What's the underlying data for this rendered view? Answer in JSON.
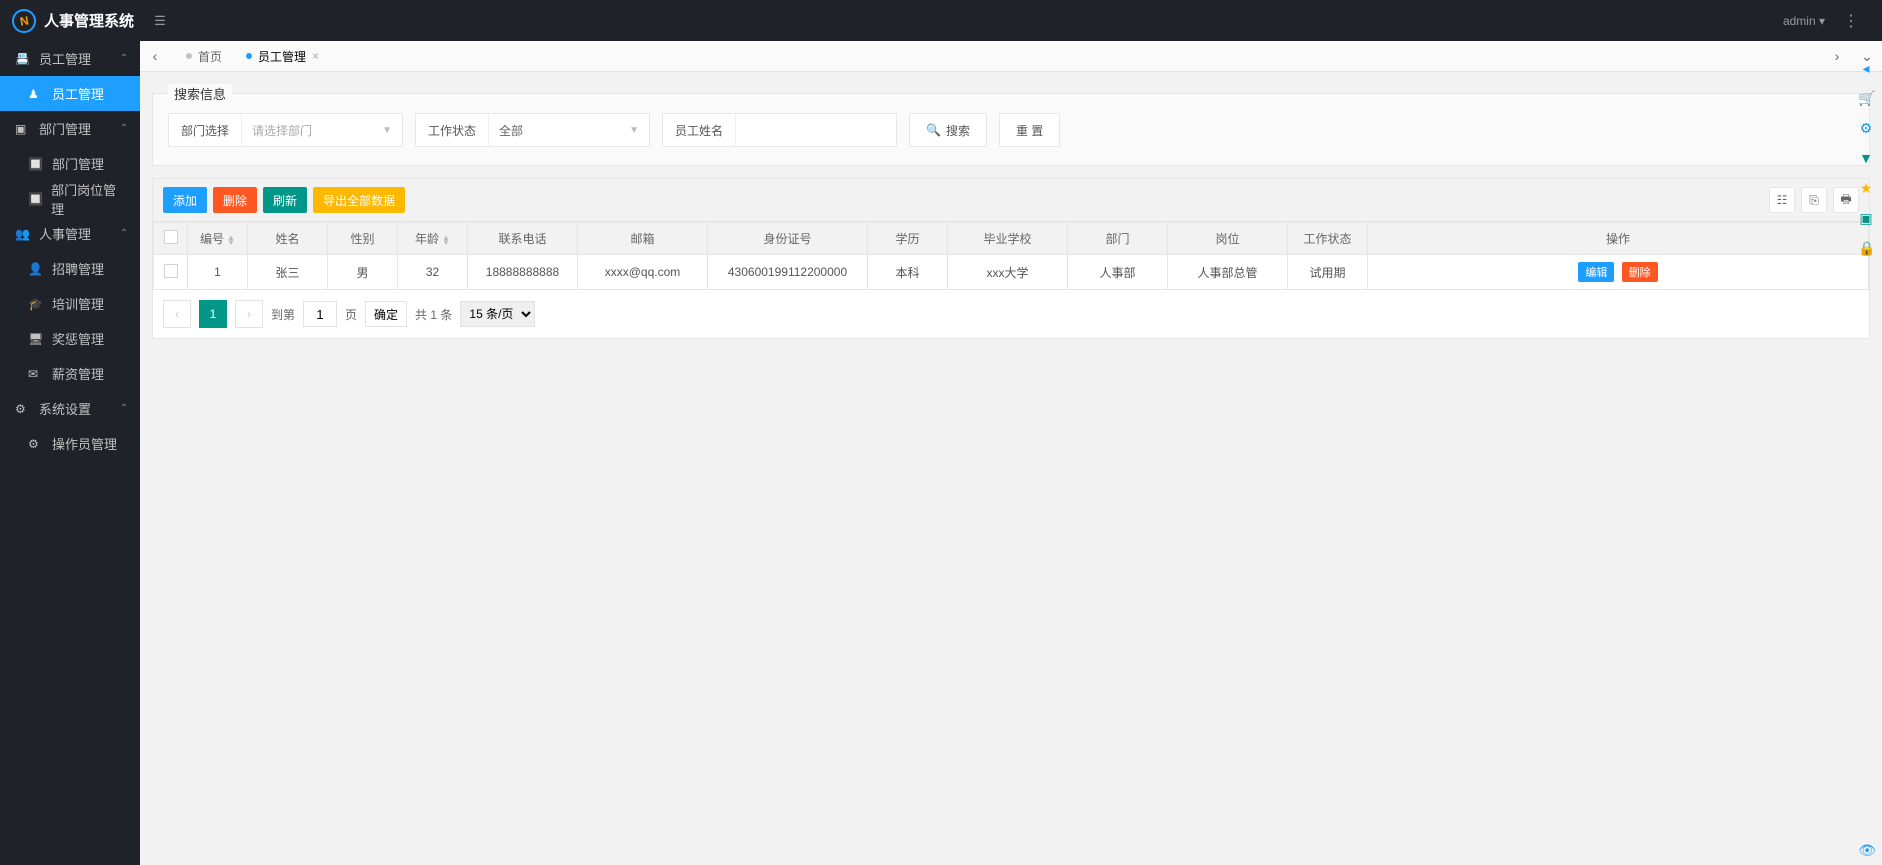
{
  "app": {
    "title": "人事管理系统",
    "user": "admin"
  },
  "sidebar": {
    "groups": [
      {
        "label": "员工管理",
        "icon": "≡"
      },
      {
        "label": "员工管理",
        "icon": "♟",
        "active": true,
        "sub": true
      },
      {
        "label": "部门管理",
        "icon": "▣"
      },
      {
        "label": "部门管理",
        "icon": "▤",
        "sub": true
      },
      {
        "label": "部门岗位管理",
        "icon": "▤",
        "sub": true
      },
      {
        "label": "人事管理",
        "icon": "⚑"
      },
      {
        "label": "招聘管理",
        "icon": "＋",
        "sub": true
      },
      {
        "label": "培训管理",
        "icon": "🎓",
        "sub": true
      },
      {
        "label": "奖惩管理",
        "icon": "🖵",
        "sub": true
      },
      {
        "label": "薪资管理",
        "icon": "✉",
        "sub": true
      },
      {
        "label": "系统设置",
        "icon": "⚙"
      },
      {
        "label": "操作员管理",
        "icon": "⚙",
        "sub": true
      }
    ]
  },
  "tabs": {
    "home": "首页",
    "current": "员工管理"
  },
  "search": {
    "legend": "搜索信息",
    "dept_label": "部门选择",
    "dept_placeholder": "请选择部门",
    "status_label": "工作状态",
    "status_value": "全部",
    "name_label": "员工姓名",
    "search_btn": "搜索",
    "reset_btn": "重 置"
  },
  "toolbar": {
    "add": "添加",
    "delete": "删除",
    "refresh": "刷新",
    "export": "导出全部数据"
  },
  "table": {
    "headers": {
      "id": "编号",
      "name": "姓名",
      "gender": "性别",
      "age": "年龄",
      "phone": "联系电话",
      "email": "邮箱",
      "idcard": "身份证号",
      "edu": "学历",
      "school": "毕业学校",
      "dept": "部门",
      "post": "岗位",
      "status": "工作状态",
      "action": "操作"
    },
    "row_action": {
      "edit": "编辑",
      "delete": "删除"
    },
    "rows": [
      {
        "id": "1",
        "name": "张三",
        "gender": "男",
        "age": "32",
        "phone": "18888888888",
        "email": "xxxx@qq.com",
        "idcard": "430600199112200000",
        "edu": "本科",
        "school": "xxx大学",
        "dept": "人事部",
        "post": "人事部总管",
        "status": "试用期"
      }
    ]
  },
  "pagination": {
    "goto_label": "到第",
    "page_suffix": "页",
    "confirm": "确定",
    "total_label": "共 1 条",
    "per_page": "15 条/页",
    "current_page": "1"
  }
}
